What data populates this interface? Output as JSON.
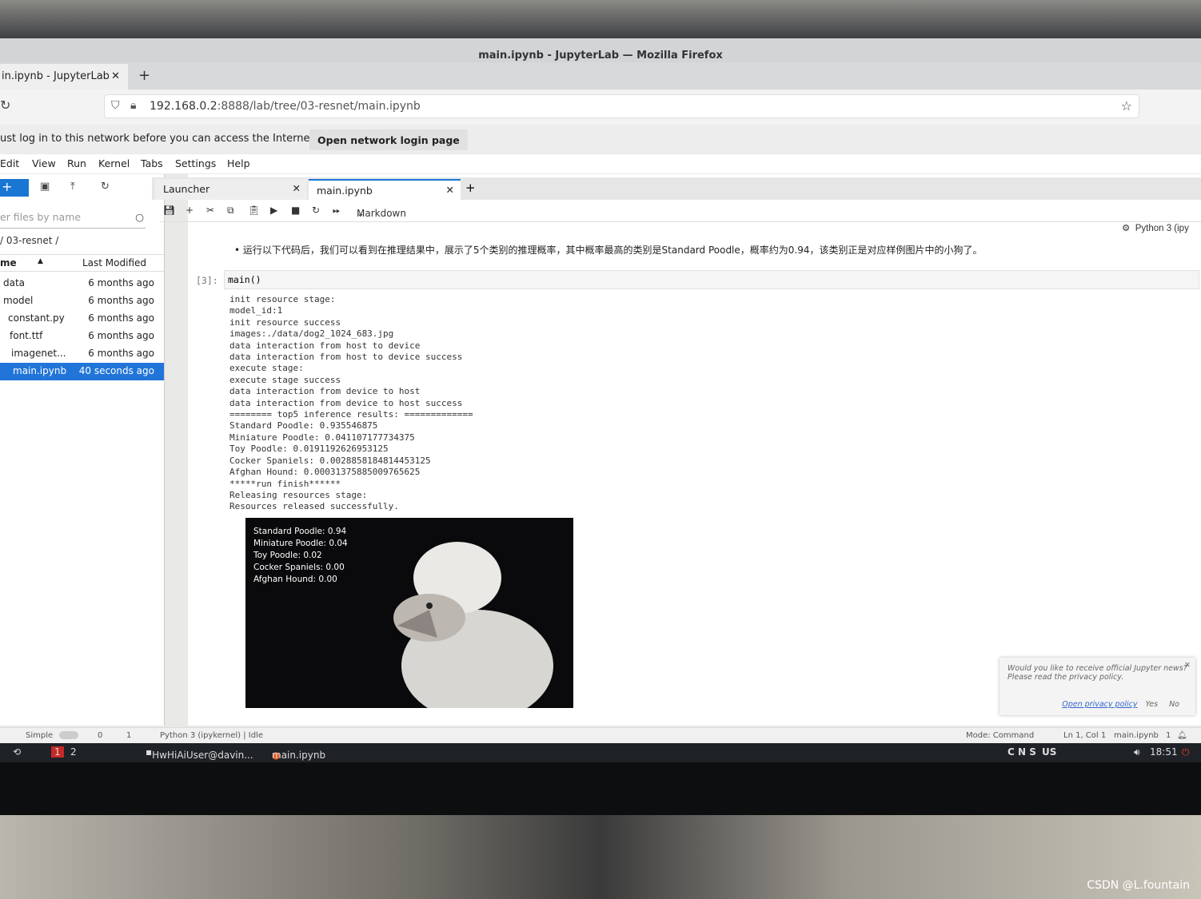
{
  "window": {
    "title": "main.ipynb - JupyterLab — Mozilla Firefox"
  },
  "browser": {
    "tab_title": "in.ipynb - JupyterLab",
    "url_host": "192.168.0.2",
    "url_path": ":8888/lab/tree/03-resnet/main.ipynb",
    "notice": "ust log in to this network before you can access the Internet.",
    "notice_button": "Open network login page"
  },
  "menu": [
    "Edit",
    "View",
    "Run",
    "Kernel",
    "Tabs",
    "Settings",
    "Help"
  ],
  "filebrowser": {
    "filter_placeholder": "er files by name",
    "breadcrumb": "/ 03-resnet /",
    "col_name": "me",
    "col_modified": "Last Modified",
    "files": [
      {
        "name": "data",
        "modified": "6 months ago"
      },
      {
        "name": "model",
        "modified": "6 months ago"
      },
      {
        "name": "constant.py",
        "modified": "6 months ago"
      },
      {
        "name": "font.ttf",
        "modified": "6 months ago"
      },
      {
        "name": "imagenet...",
        "modified": "6 months ago"
      },
      {
        "name": "main.ipynb",
        "modified": "40 seconds ago",
        "selected": true
      }
    ]
  },
  "doc_tabs": [
    {
      "label": "Launcher"
    },
    {
      "label": "main.ipynb",
      "active": true
    }
  ],
  "notebook": {
    "cell_type": "Markdown",
    "kernel": "Python 3 (ipy",
    "markdown": "运行以下代码后，我们可以看到在推理结果中，展示了5个类别的推理概率，其中概率最高的类别是Standard Poodle，概率约为0.94，该类别正是对应样例图片中的小狗了。",
    "prompt": "[3]:",
    "code": "main()",
    "output": [
      "init resource stage:",
      "model_id:1",
      "init resource success",
      "images:./data/dog2_1024_683.jpg",
      "data interaction from host to device",
      "data interaction from host to device success",
      "execute stage:",
      "execute stage success",
      "data interaction from device to host",
      "data interaction from device to host success",
      "======== top5 inference results: =============",
      "Standard Poodle: 0.935546875",
      "Miniature Poodle: 0.041107177734375",
      "Toy Poodle: 0.0191192626953125",
      "Cocker Spaniels: 0.0028858184814453125",
      "Afghan Hound: 0.00031375885009765625",
      "*****run finish******",
      "Releasing resources stage:",
      "Resources released successfully."
    ],
    "image_labels": [
      "Standard Poodle: 0.94",
      "Miniature Poodle: 0.04",
      "Toy Poodle: 0.02",
      "Cocker Spaniels: 0.00",
      "Afghan Hound: 0.00"
    ]
  },
  "toast": {
    "text1": "Would you like to receive official Jupyter news?",
    "text2": "Please read the privacy policy.",
    "link": "Open privacy policy",
    "yes": "Yes",
    "no": "No"
  },
  "statusbar": {
    "mode_label": "Simple",
    "count0": "0",
    "count1": "1",
    "kernel": "Python 3 (ipykernel) | Idle",
    "mode": "Mode: Command",
    "position": "Ln 1, Col 1",
    "file": "main.ipynb",
    "notifications": "1"
  },
  "taskbar": {
    "ws1": "1",
    "ws2": "2",
    "terminal": "HwHiAiUser@davin...",
    "firefox": "main.ipynb - Jupyte...",
    "ime": "C N S",
    "layout": "US",
    "time": "18:51"
  },
  "watermark": "CSDN @L.fountain"
}
